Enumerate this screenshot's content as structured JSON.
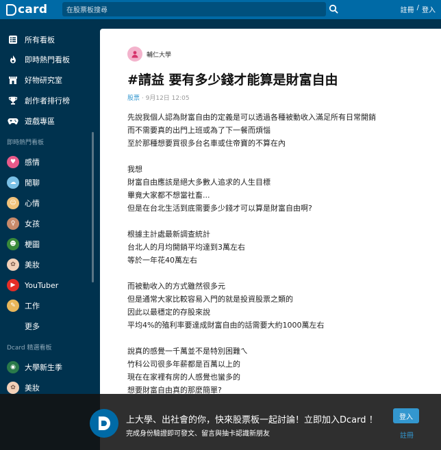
{
  "header": {
    "logo_text": "card",
    "search_placeholder": "在股票板搜尋",
    "login": "註冊",
    "divider": "/",
    "signup": "登入"
  },
  "sidebar": {
    "main_items": [
      {
        "label": "所有看板",
        "icon": "board-list-icon"
      },
      {
        "label": "即時熱門看板",
        "icon": "fire-icon"
      },
      {
        "label": "好物研究室",
        "icon": "shop-icon"
      },
      {
        "label": "創作者排行榜",
        "icon": "trophy-icon"
      },
      {
        "label": "遊戲專區",
        "icon": "gamepad-icon"
      }
    ],
    "hot_section": "即時熱門看板",
    "hot_items": [
      {
        "label": "感情",
        "color": "#e85a8a"
      },
      {
        "label": "閒聊",
        "color": "#7ac0e6"
      },
      {
        "label": "心情",
        "color": "#f0c27a"
      },
      {
        "label": "女孩",
        "color": "#c88a6a"
      },
      {
        "label": "梗圖",
        "color": "#3a8a3a"
      },
      {
        "label": "美妝",
        "color": "#f2d0b8"
      },
      {
        "label": "YouTuber",
        "color": "#e52d27"
      },
      {
        "label": "工作",
        "color": "#e8b65a"
      }
    ],
    "more": "更多",
    "featured_section": "Dcard 精選看板",
    "featured_items": [
      {
        "label": "大學新生季",
        "color": "#2a7a4a"
      },
      {
        "label": "美妝",
        "color": "#f2d0b8"
      }
    ]
  },
  "post": {
    "board": "輔仁大學",
    "title": "#請益 要有多少錢才能算是財富自由",
    "tag": "股票",
    "date": "9月12日 12:05",
    "lines": [
      "先說我個人認為財富自由的定義是可以透過各種被動收入滿足所有日常開銷",
      "而不需要真的出門上班或為了下一餐而煩惱",
      "至於那種想要買很多台名車或住帝寶的不算在內",
      "",
      "我想",
      "財富自由應該是絕大多數人追求的人生目標",
      "畢竟大家都不想當社畜...",
      "但是在台北生活到底需要多少錢才可以算是財富自由啊?",
      "",
      "根據主計處最新調查統計",
      "台北人的月均開銷平均達到3萬左右",
      "等於一年花40萬左右",
      "",
      "而被動收入的方式雖然很多元",
      "但是通常大家比較容易入門的就是投資股票之類的",
      "因此以最穩定的存股來說",
      "平均4%的殖利率要達成財富自由的話需要大約1000萬左右",
      "",
      "說真的感覺一千萬並不是特別困難ㄟ",
      "竹科公司很多年薪都是百萬以上的",
      "現在在家裡有房的人感覺也蠻多的",
      "想要財富自由真的那麼簡單?"
    ]
  },
  "banner": {
    "title": "上大學、出社會的你，快來股票板一起討論！立即加入Dcard ！",
    "subtitle": "完成身份驗證即可發文、留言與抽卡認識新朋友",
    "login_button": "登入",
    "register_link": "註冊"
  }
}
